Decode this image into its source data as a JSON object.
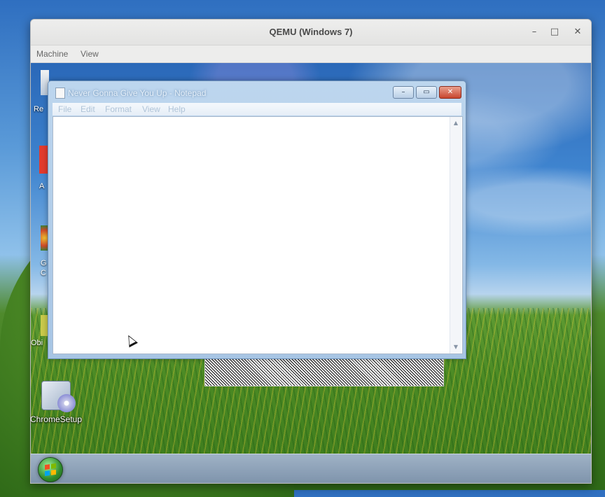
{
  "qemu": {
    "title": "QEMU (Windows 7)",
    "menu": [
      "Machine",
      "View"
    ],
    "controls": {
      "minimize": "–",
      "maximize": "□",
      "close": "✕"
    }
  },
  "desktop": {
    "icons": [
      {
        "label": "ChromeSetup",
        "icon": "installer-icon"
      }
    ],
    "partial_labels": [
      "Re",
      "A",
      "G",
      "C",
      "Obi"
    ]
  },
  "notepad": {
    "title": "Never Gonna Give You Up - Notepad",
    "menu": [
      "File",
      "Edit",
      "Format",
      "View",
      "Help"
    ],
    "content": ""
  },
  "colors": {
    "qemu_chrome": "#e8e8e7",
    "notepad_frame": "#a7c5e4",
    "taskbar": "#8ea3ba"
  }
}
